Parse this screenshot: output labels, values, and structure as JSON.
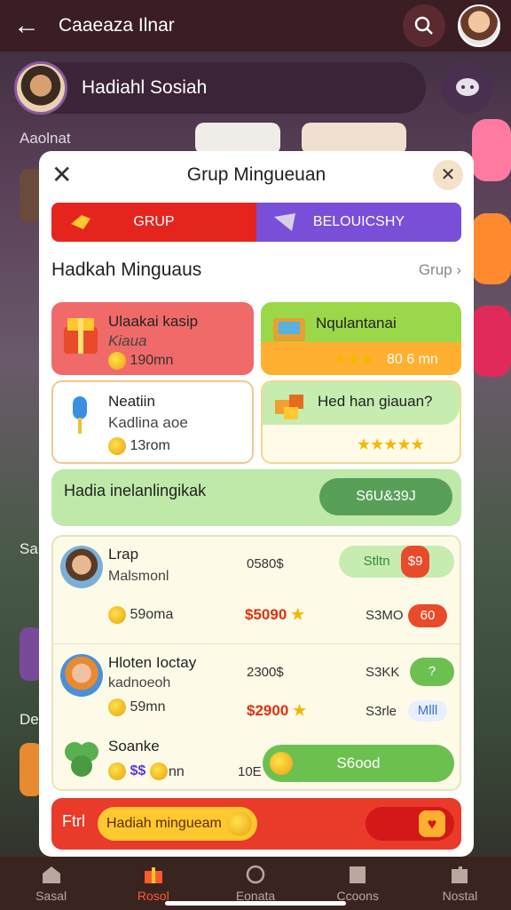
{
  "header": {
    "title": "Caaeaza Ilnar"
  },
  "social": {
    "label": "Hadiahl Sosiah"
  },
  "background": {
    "section_label": "Aaolnat",
    "side_label_1": "Sa",
    "side_label_2": "De"
  },
  "modal": {
    "title": "Grup Mingueuan",
    "tabs": [
      {
        "label": "GRUP",
        "color": "#e6241e"
      },
      {
        "label": "BELOUICSHY",
        "color": "#7a4fd8"
      }
    ],
    "section": {
      "heading": "Hadkah Minguaus",
      "link": "Grup"
    },
    "tiles": [
      {
        "name": "Ulaakai kasip",
        "sub": "Kiaua",
        "value": "190mn"
      },
      {
        "name": "Nqulantanai",
        "value": "80 6 mn",
        "stars": 3
      },
      {
        "name": "Neatiin",
        "sub": "Kadlina aoe",
        "value": "13rom"
      },
      {
        "name": "Hed han giauan?",
        "stars": 5
      }
    ],
    "banner": {
      "text": "Hadia inelanlingikak",
      "button": "S6U&39J"
    },
    "rows": [
      {
        "name": "Lrap",
        "sub": "Malsmonl",
        "num": "0580$",
        "pill": "Stltn",
        "pill_badge": "$9",
        "value": "59oma",
        "price": "$5090",
        "stat": "S3MO",
        "stat_badge": "60"
      },
      {
        "name": "Hloten Ioctay",
        "sub": "kadnoeoh",
        "num": "2300$",
        "stat": "S3KK",
        "pill": "?",
        "value": "59mn",
        "price": "$2900",
        "stat2": "S3rle",
        "stat2_badge": "Mlll"
      },
      {
        "name": "Soanke",
        "sub": "$$",
        "value": "nn",
        "num": "10E",
        "button": "S6ood"
      }
    ],
    "footer": {
      "label": "Ftrl",
      "pill": "Hadiah mingueam"
    }
  },
  "bottom_nav": [
    {
      "label": "Sasal",
      "active": false
    },
    {
      "label": "Rosol",
      "active": true
    },
    {
      "label": "Eonata",
      "active": false
    },
    {
      "label": "Ccoons",
      "active": false
    },
    {
      "label": "Nostal",
      "active": false
    }
  ],
  "colors": {
    "accent_red": "#e6241e",
    "accent_purple": "#7a4fd8",
    "accent_green": "#6cc050"
  }
}
